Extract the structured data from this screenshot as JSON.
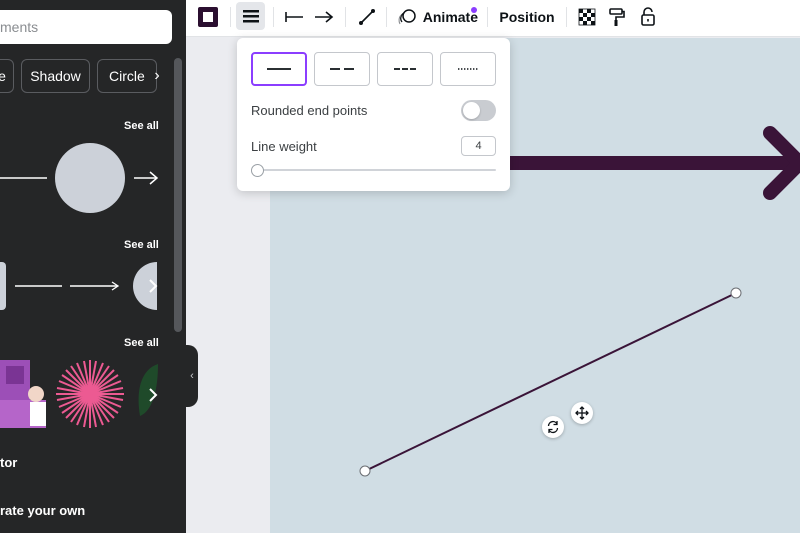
{
  "sidebar": {
    "search_placeholder": "ments",
    "chips": [
      "e",
      "Shadow",
      "Circle"
    ],
    "see_all": "See all",
    "section_labels": [
      "tor",
      "rate your own"
    ]
  },
  "toolbar": {
    "animate_label": "Animate",
    "position_label": "Position",
    "accent_color": "#2b0f30",
    "dot_color": "#8b3dff"
  },
  "line_popover": {
    "styles": [
      "solid",
      "long-dash",
      "dash",
      "dotted"
    ],
    "selected_style": "solid",
    "rounded_label": "Rounded end points",
    "rounded_enabled": false,
    "weight_label": "Line weight",
    "weight_value": "4"
  },
  "canvas": {
    "background": "#d0dde4",
    "element_color": "#3a1438"
  }
}
